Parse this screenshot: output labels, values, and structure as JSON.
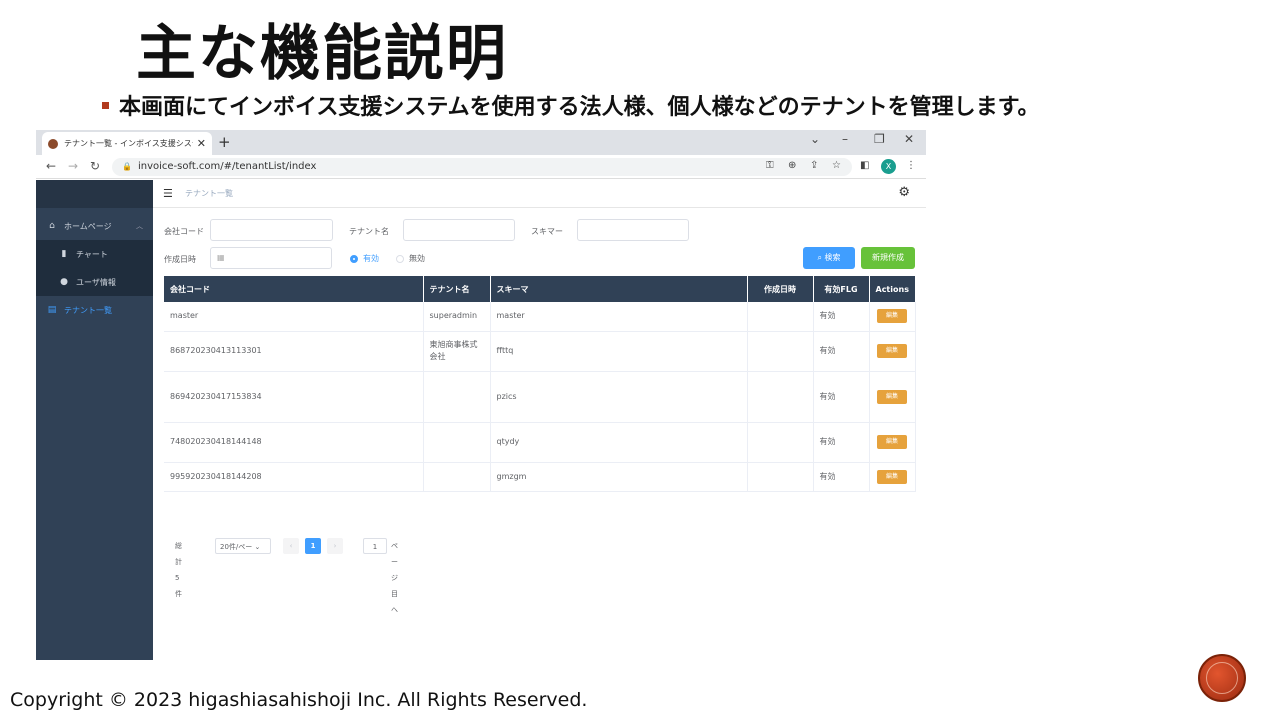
{
  "slide": {
    "title": "主な機能説明",
    "bullet": "本画面にてインボイス支援システムを使用する法人様、個人様などのテナントを管理します。",
    "footer": "Copyright © 2023 higashiasahishoji Inc. All Rights Reserved.",
    "accent_color": "#b23a1e"
  },
  "browser": {
    "tab_title": "テナント一覧 - インボイス支援システム",
    "tab_close": "✕",
    "new_tab": "+",
    "url": "invoice-soft.com/#/tenantList/index",
    "profile_initial": "X"
  },
  "sidebar": {
    "items": [
      {
        "label": "ホームページ",
        "icon": "home-icon"
      },
      {
        "label": "チャート",
        "icon": "bar-chart-icon"
      },
      {
        "label": "ユーザ情報",
        "icon": "user-icon"
      },
      {
        "label": "テナント一覧",
        "icon": "table-icon"
      }
    ]
  },
  "navbar": {
    "breadcrumb": "テナント一覧"
  },
  "filters": {
    "company_code_label": "会社コード",
    "tenant_name_label": "テナント名",
    "schema_label": "スキマー",
    "created_label": "作成日時",
    "radio_valid": "有効",
    "radio_invalid": "無効",
    "search_button": "検索",
    "new_button": "新規作成"
  },
  "table": {
    "headers": [
      "会社コード",
      "テナント名",
      "スキーマ",
      "作成日時",
      "有効FLG",
      "Actions"
    ],
    "rows": [
      {
        "code": "master",
        "name": "superadmin",
        "schema": "master",
        "created": "",
        "flag": "有効",
        "action": "編集"
      },
      {
        "code": "868720230413113301",
        "name": "東旭商事株式会社",
        "schema": "ffttq",
        "created": "",
        "flag": "有効",
        "action": "編集"
      },
      {
        "code": "869420230417153834",
        "name": "",
        "schema": "pzics",
        "created": "",
        "flag": "有効",
        "action": "編集"
      },
      {
        "code": "748020230418144148",
        "name": "",
        "schema": "qtydy",
        "created": "",
        "flag": "有効",
        "action": "編集"
      },
      {
        "code": "995920230418144208",
        "name": "",
        "schema": "gmzgm",
        "created": "",
        "flag": "有効",
        "action": "編集"
      }
    ]
  },
  "pagination": {
    "total": "総計 5 件",
    "page_size": "20件/ペー",
    "prev": "‹",
    "current": "1",
    "next": "›",
    "jump_value": "1",
    "jump_suffix": "ページ目へ"
  }
}
